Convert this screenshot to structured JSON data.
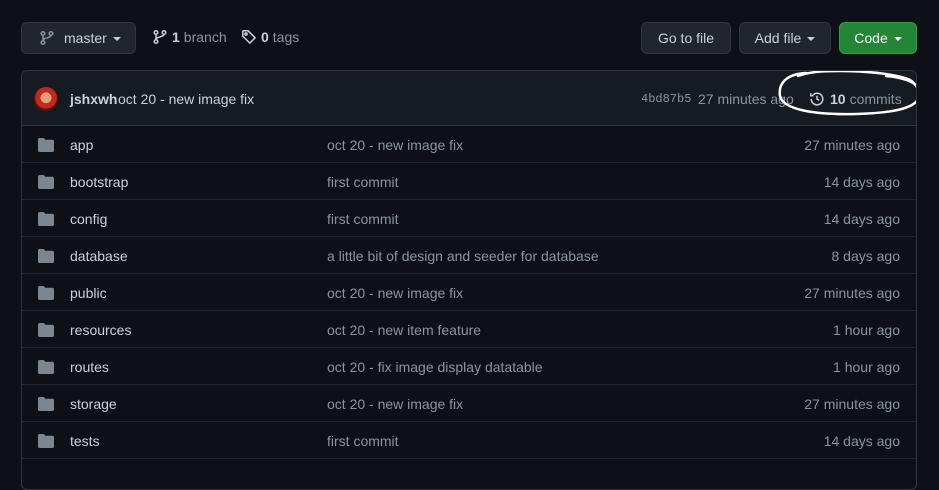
{
  "toolbar": {
    "branch": "master",
    "branch_count": "1",
    "branch_label": "branch",
    "tag_count": "0",
    "tag_label": "tags",
    "goto_file": "Go to file",
    "add_file": "Add file",
    "code": "Code"
  },
  "latest_commit": {
    "author": "jshxwh",
    "message": "oct 20 - new image fix",
    "sha": "4bd87b5",
    "time": "27 minutes ago",
    "commit_count": "10",
    "commit_label": "commits"
  },
  "files": [
    {
      "name": "app",
      "message": "oct 20 - new image fix",
      "age": "27 minutes ago"
    },
    {
      "name": "bootstrap",
      "message": "first commit",
      "age": "14 days ago"
    },
    {
      "name": "config",
      "message": "first commit",
      "age": "14 days ago"
    },
    {
      "name": "database",
      "message": "a little bit of design and seeder for database",
      "age": "8 days ago"
    },
    {
      "name": "public",
      "message": "oct 20 - new image fix",
      "age": "27 minutes ago"
    },
    {
      "name": "resources",
      "message": "oct 20 - new item feature",
      "age": "1 hour ago"
    },
    {
      "name": "routes",
      "message": "oct 20 - fix image display datatable",
      "age": "1 hour ago"
    },
    {
      "name": "storage",
      "message": "oct 20 - new image fix",
      "age": "27 minutes ago"
    },
    {
      "name": "tests",
      "message": "first commit",
      "age": "14 days ago"
    }
  ],
  "icons": {
    "branch": "git-branch-icon",
    "tag": "tag-icon",
    "history": "history-icon",
    "folder": "folder-icon"
  },
  "colors": {
    "background": "#0d1117",
    "header_bg": "#161b22",
    "border": "#30363d",
    "text": "#c9d1d9",
    "muted": "#8b949e",
    "folder": "#7d8590",
    "code_button": "#238636"
  }
}
